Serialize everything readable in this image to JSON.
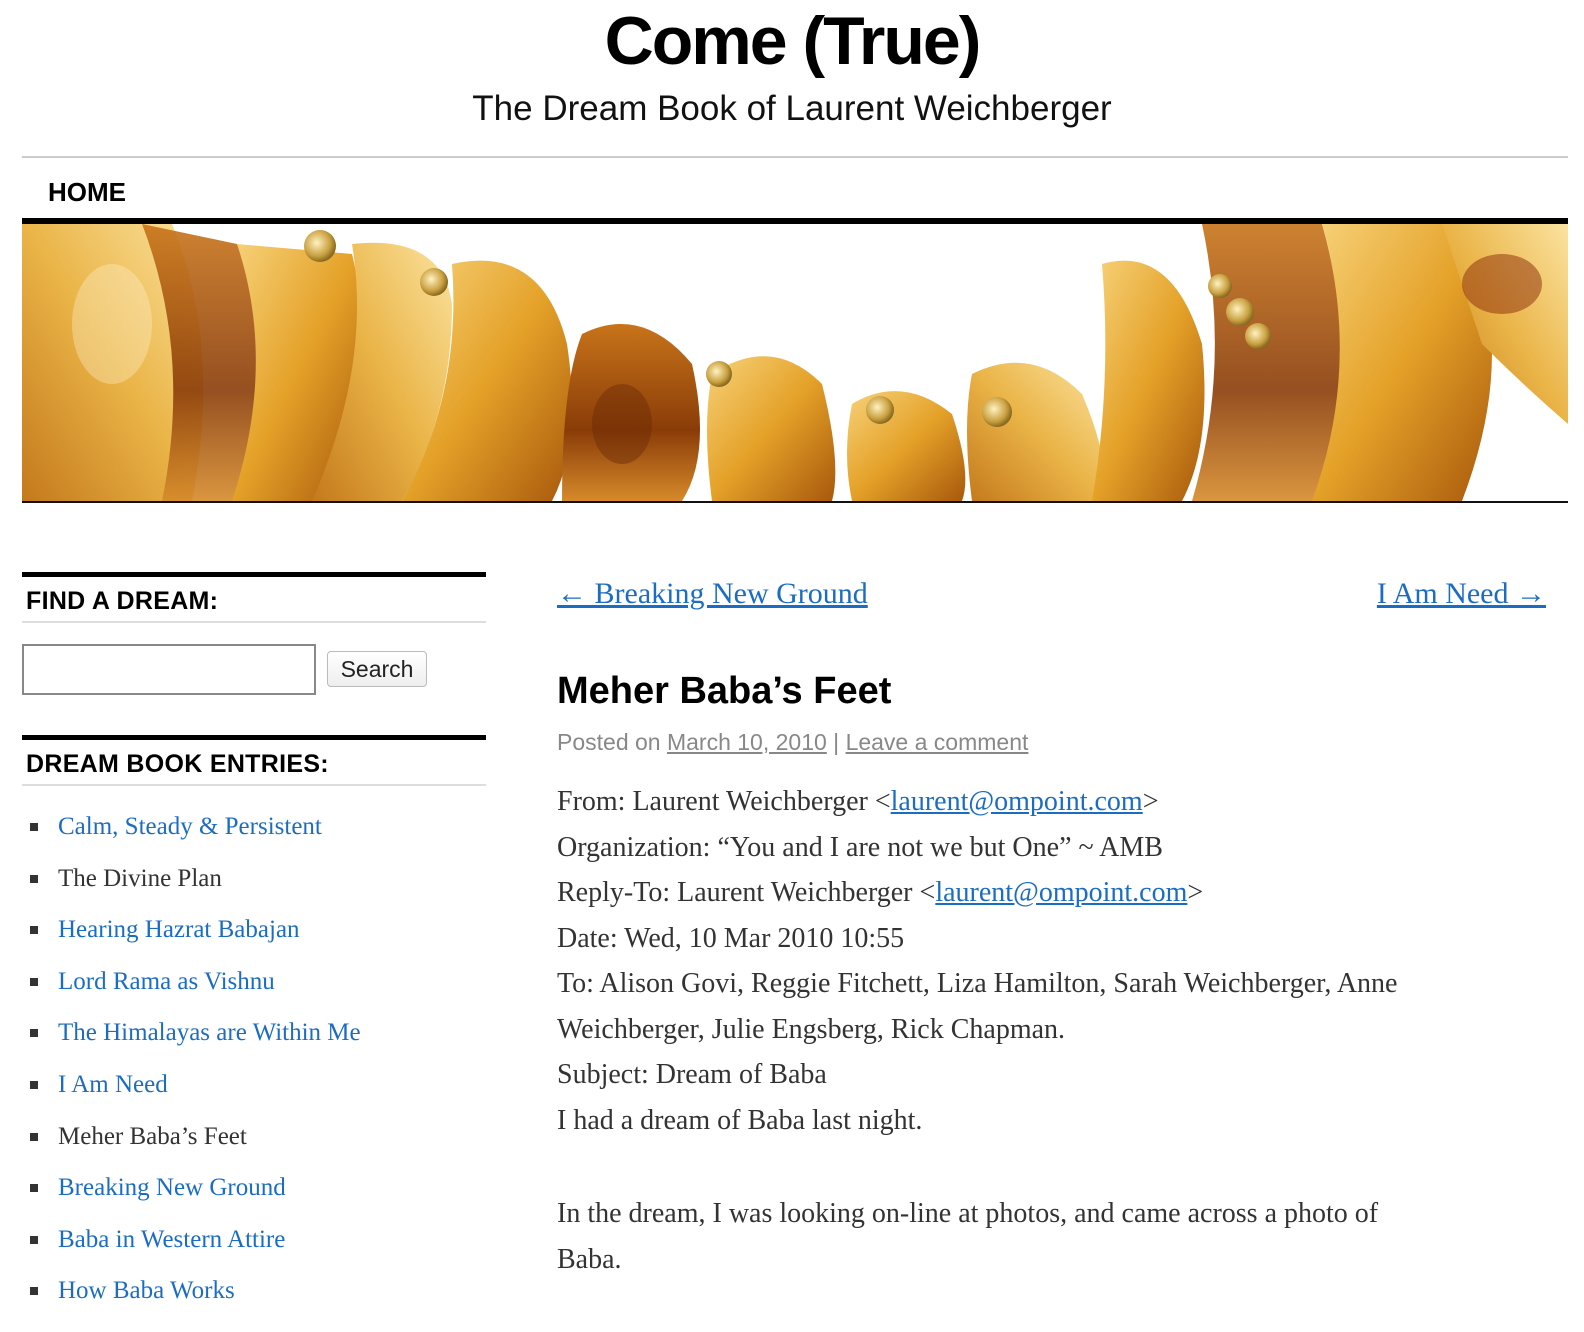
{
  "site": {
    "title": "Come (True)",
    "description": "The Dream Book of Laurent Weichberger"
  },
  "nav": {
    "home_label": "HOME"
  },
  "banner": {
    "image_alt": "amber beads banner"
  },
  "sidebar": {
    "search_widget": {
      "title": "FIND A DREAM:",
      "input_value": "",
      "button_label": "Search"
    },
    "entries_widget": {
      "title": "DREAM BOOK ENTRIES:",
      "items": [
        {
          "label": "Calm, Steady & Persistent",
          "link": true
        },
        {
          "label": "The Divine Plan",
          "link": false
        },
        {
          "label": "Hearing Hazrat Babajan",
          "link": true
        },
        {
          "label": "Lord Rama as Vishnu",
          "link": true
        },
        {
          "label": "The Himalayas are Within Me",
          "link": true
        },
        {
          "label": "I Am Need",
          "link": true
        },
        {
          "label": "Meher Baba’s Feet",
          "link": false
        },
        {
          "label": "Breaking New Ground",
          "link": true
        },
        {
          "label": "Baba in Western Attire",
          "link": true
        },
        {
          "label": "How Baba Works",
          "link": true
        }
      ]
    }
  },
  "post_nav": {
    "previous": "← Breaking New Ground",
    "next": "I Am Need →"
  },
  "post": {
    "title": "Meher Baba’s Feet",
    "meta_prefix": "Posted on ",
    "date": "March 10, 2010",
    "separator": " | ",
    "comment_link": "Leave a comment",
    "from_prefix": "From: Laurent Weichberger <",
    "from_email": "laurent@ompoint.com",
    "from_suffix": ">",
    "organization": "Organization: “You and I are not we but One” ~ AMB",
    "reply_prefix": "Reply-To: Laurent Weichberger <",
    "reply_email": "laurent@ompoint.com",
    "reply_suffix": ">",
    "date_line": "Date: Wed, 10 Mar 2010 10:55",
    "to_line_1": "To: Alison Govi, Reggie Fitchett, Liza Hamilton, Sarah Weichberger, Anne",
    "to_line_2": "Weichberger, Julie Engsberg, Rick Chapman.",
    "subject": "Subject: Dream of Baba",
    "para_1": "I had a dream of Baba last night.",
    "para_2_line_1": "In the dream, I was looking on-line at photos, and came across a photo of",
    "para_2_line_2": "Baba."
  },
  "colors": {
    "link": "#1b6dc4",
    "meta": "#888888",
    "body_text": "#333333"
  }
}
